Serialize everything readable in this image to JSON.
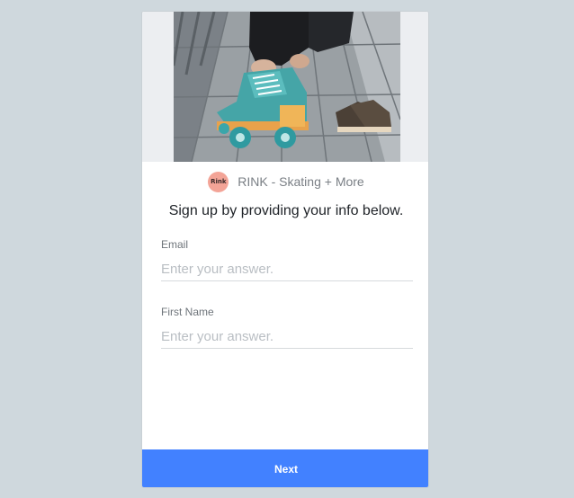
{
  "brand": {
    "logo_text": "Rink",
    "name": "RINK - Skating + More"
  },
  "form": {
    "headline": "Sign up by providing your info below.",
    "fields": [
      {
        "label": "Email",
        "placeholder": "Enter your answer.",
        "value": ""
      },
      {
        "label": "First Name",
        "placeholder": "Enter your answer.",
        "value": ""
      }
    ],
    "next_label": "Next"
  },
  "colors": {
    "page_background": "#cfd8dd",
    "accent": "#4281ff",
    "logo_background": "#f3a497"
  },
  "hero_image": {
    "subject": "teal roller skates on a wooden boardwalk"
  }
}
